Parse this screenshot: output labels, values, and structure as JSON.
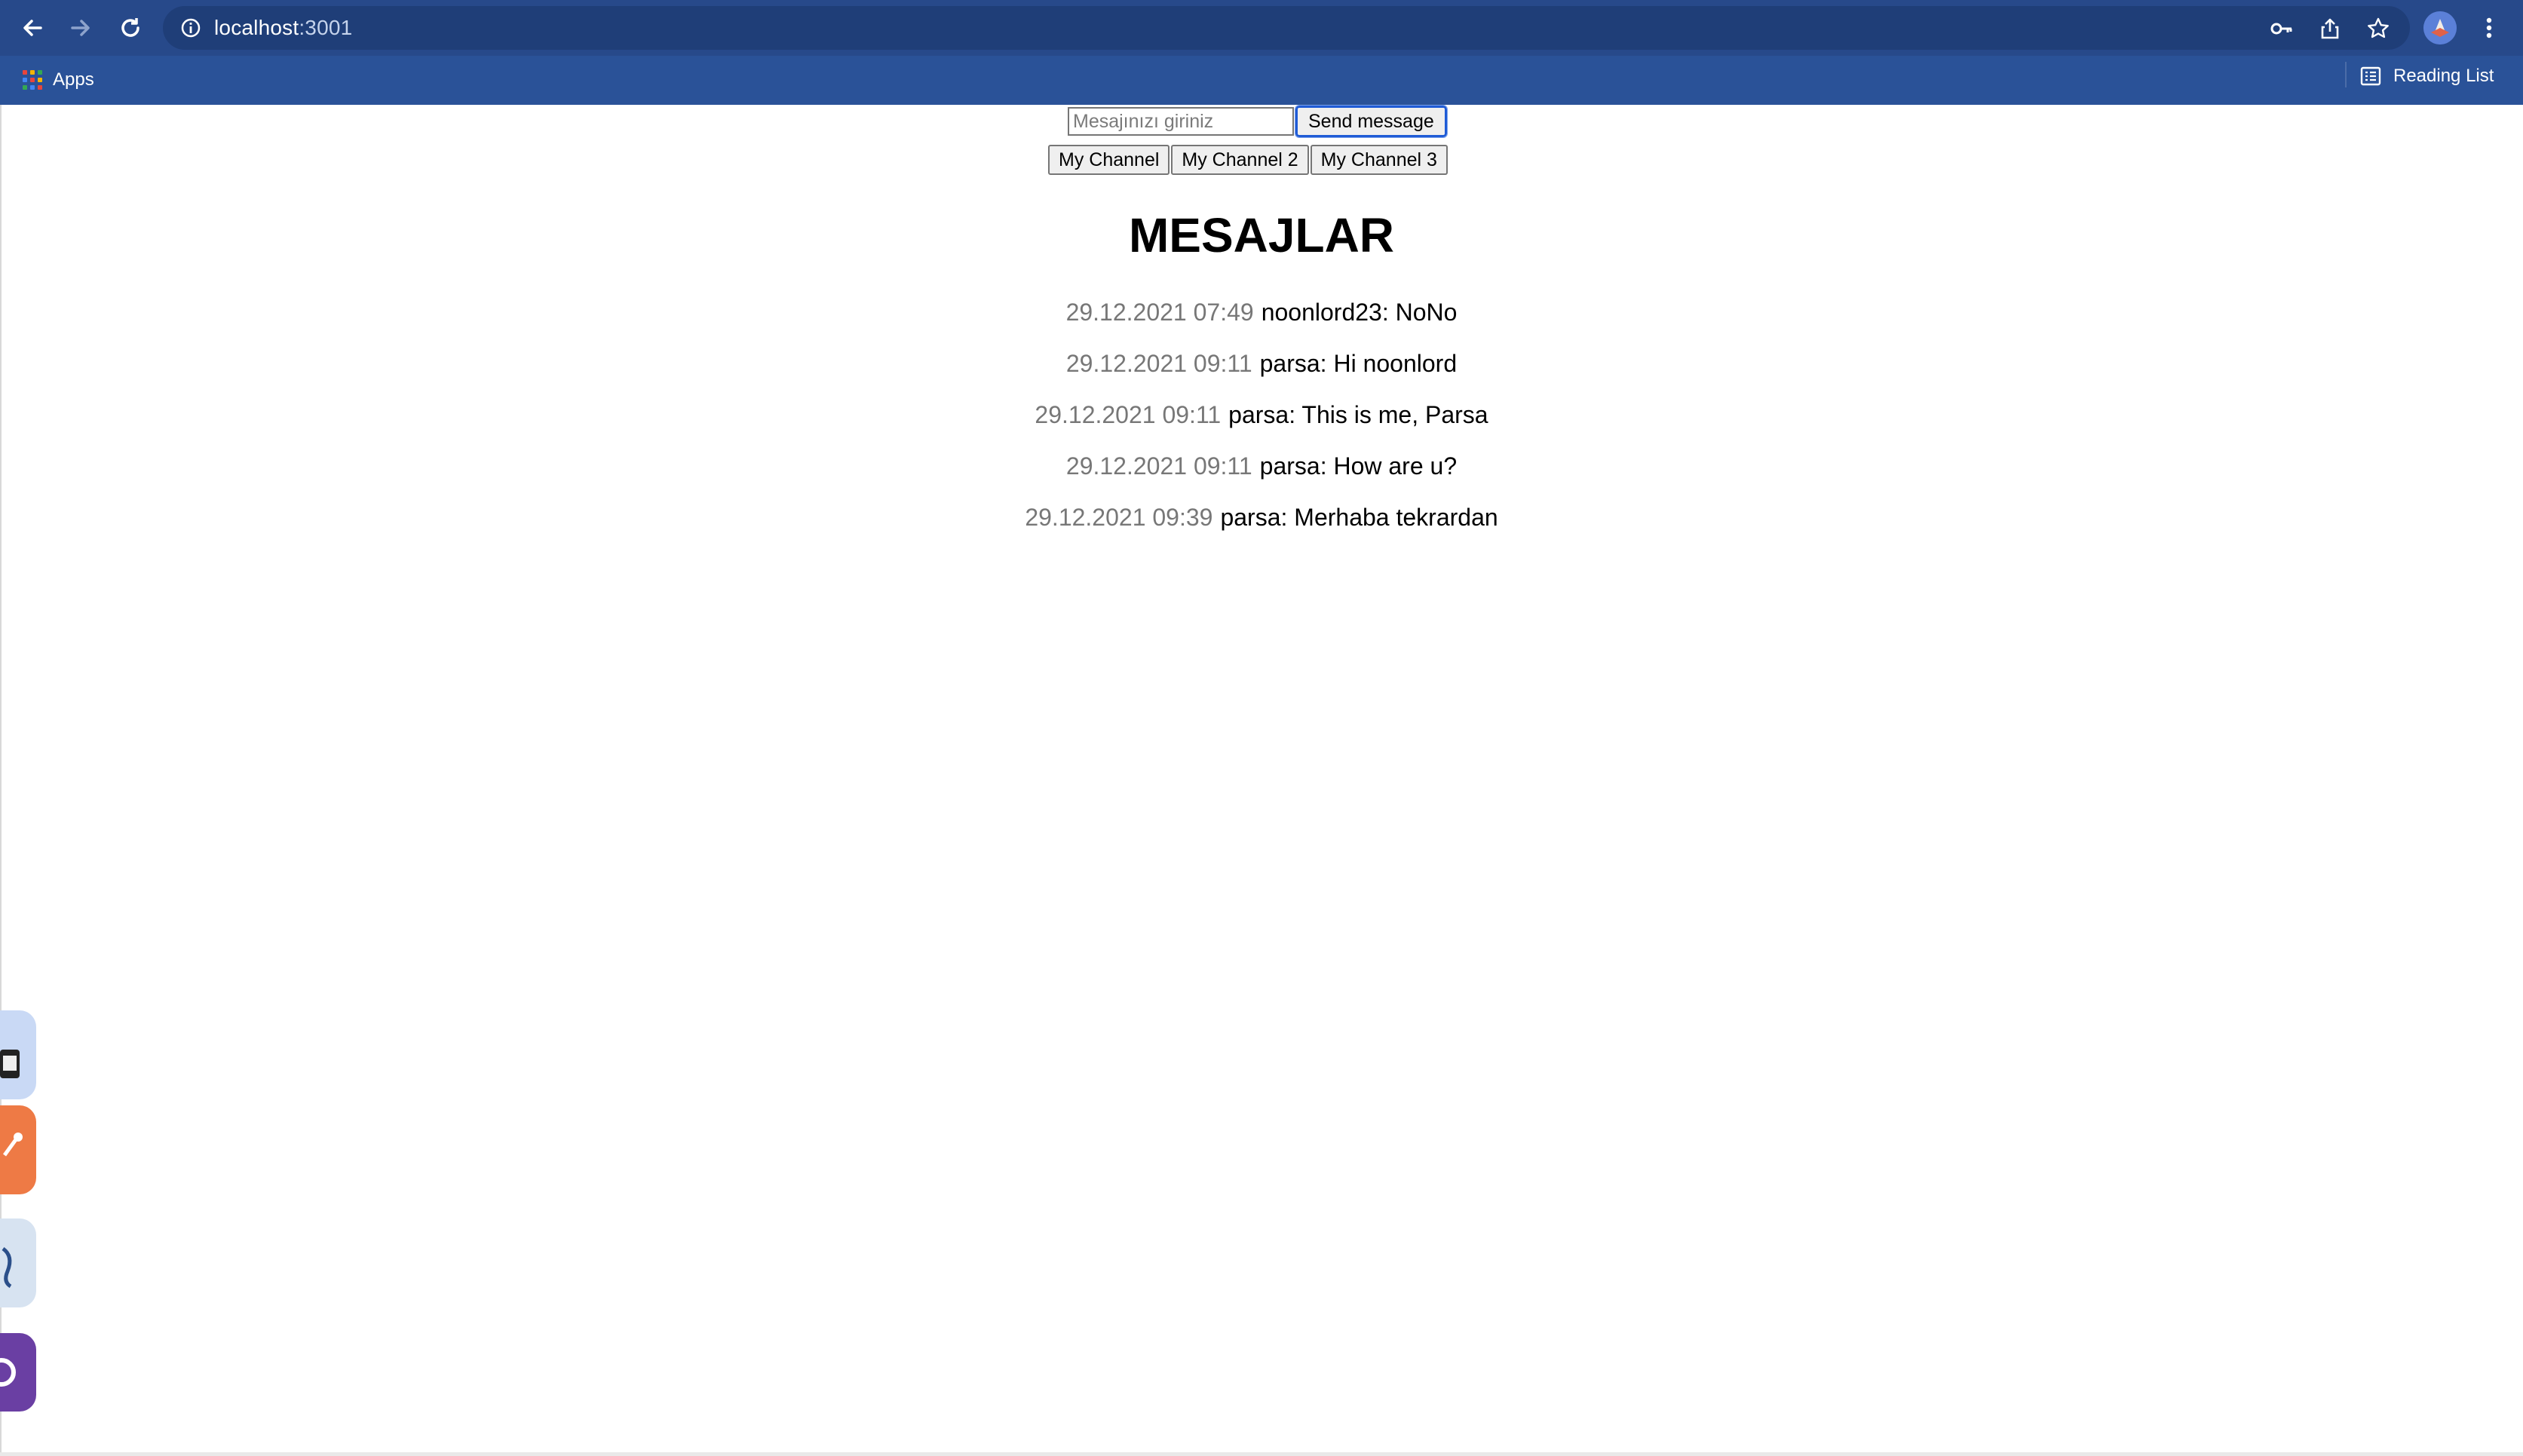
{
  "browser": {
    "url_host": "localhost",
    "url_port": ":3001",
    "bookmarks": {
      "apps_label": "Apps",
      "reading_list_label": "Reading List"
    },
    "icons": [
      "back-icon",
      "forward-icon",
      "reload-icon",
      "info-icon",
      "key-icon",
      "share-icon",
      "star-icon",
      "profile-icon",
      "menu-icon"
    ]
  },
  "composer": {
    "input_placeholder": "Mesajınızı giriniz",
    "input_value": "",
    "send_label": "Send message"
  },
  "channels": [
    {
      "label": "My Channel"
    },
    {
      "label": "My Channel 2"
    },
    {
      "label": "My Channel 3"
    }
  ],
  "page_title": "MESAJLAR",
  "messages": [
    {
      "time": "29.12.2021 07:49",
      "text": "noonlord23: NoNo"
    },
    {
      "time": "29.12.2021 09:11",
      "text": "parsa: Hi noonlord"
    },
    {
      "time": "29.12.2021 09:11",
      "text": "parsa: This is me, Parsa"
    },
    {
      "time": "29.12.2021 09:11",
      "text": "parsa: How are u?"
    },
    {
      "time": "29.12.2021 09:39",
      "text": "parsa: Merhaba tekrardan"
    }
  ],
  "colors": {
    "toolbar": "#27498a",
    "bookmarks_bar": "#2a5298",
    "timestamp": "#777777",
    "focus_ring": "#1f5bd6"
  }
}
